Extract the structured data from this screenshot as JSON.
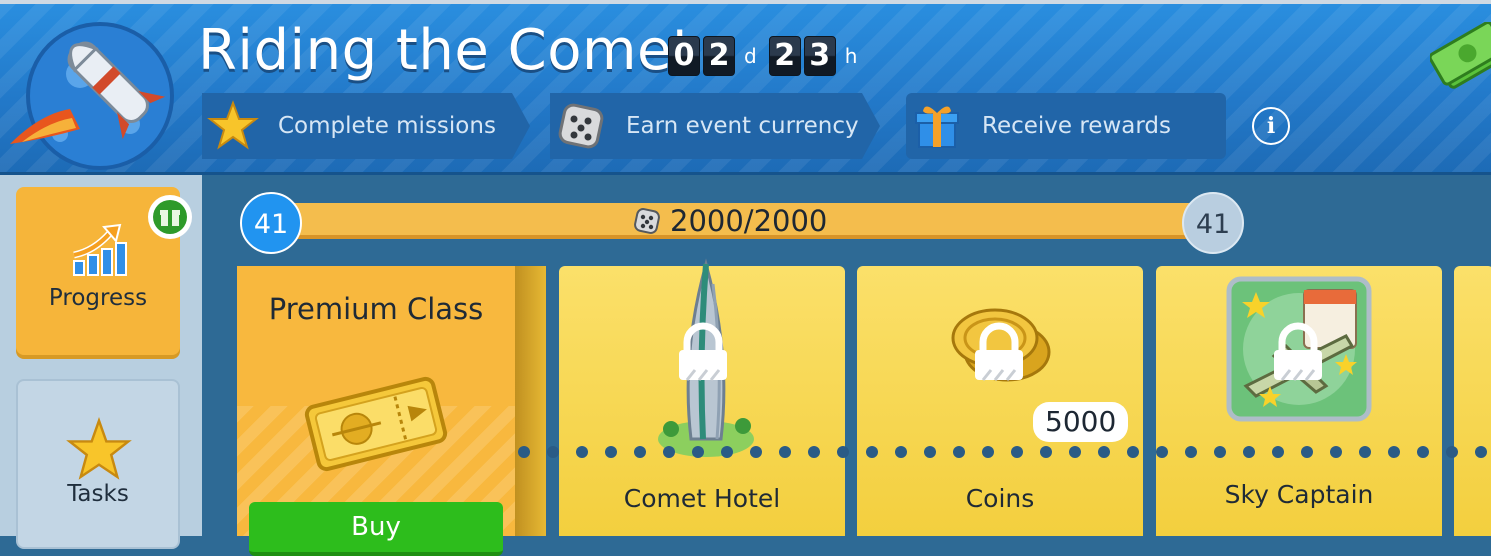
{
  "header": {
    "title": "Riding the Comet",
    "timer": {
      "days_digits": [
        "0",
        "2"
      ],
      "days_unit": "d",
      "hours_digits": [
        "2",
        "3"
      ],
      "hours_unit": "h"
    },
    "steps": [
      {
        "label": "Complete missions",
        "icon": "star-icon"
      },
      {
        "label": "Earn event currency",
        "icon": "dice-icon"
      },
      {
        "label": "Receive rewards",
        "icon": "gift-icon"
      }
    ],
    "info_label": "i"
  },
  "sidebar": {
    "items": [
      {
        "label": "Progress",
        "icon": "rising-chart-icon",
        "active": true,
        "badge_icon": "gift-icon"
      },
      {
        "label": "Tasks",
        "icon": "star-icon",
        "active": false
      }
    ]
  },
  "progress": {
    "current_level": "41",
    "next_level": "41",
    "currency_icon": "dice-icon",
    "text": "2000/2000",
    "fraction": 1.0
  },
  "premium": {
    "title": "Premium Class",
    "icon": "golden-ticket-icon",
    "buy_label": "Buy"
  },
  "rewards": [
    {
      "name": "Comet Hotel",
      "icon": "hotel-tower-icon",
      "locked": true,
      "amount": ""
    },
    {
      "name": "Coins",
      "icon": "coins-icon",
      "locked": true,
      "amount": "5000"
    },
    {
      "name": "Sky Captain",
      "icon": "sky-captain-plane-icon",
      "locked": true,
      "amount": ""
    }
  ],
  "colors": {
    "header_blue": "#2278c8",
    "progress_orange": "#f2b84a",
    "card_yellow": "#f3cf3e",
    "buy_green": "#2dbd1c",
    "level_blue": "#2194f0"
  }
}
